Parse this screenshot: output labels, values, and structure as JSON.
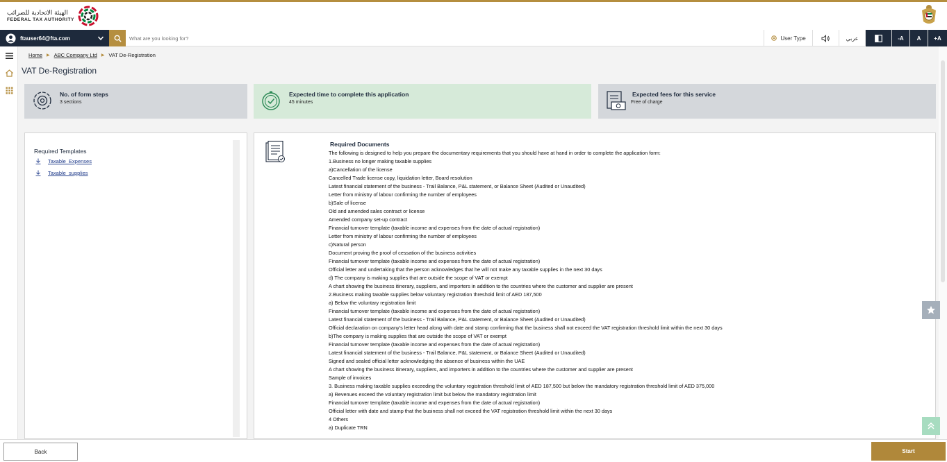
{
  "header": {
    "logo_arabic": "الهيئة الاتحادية للضرائب",
    "logo_english": "FEDERAL TAX AUTHORITY"
  },
  "toolbar": {
    "user_email": "ftauser64@fta.com",
    "search_placeholder": "What are you looking for?",
    "user_type_label": "User Type",
    "arabic_label": "عربي",
    "font_small": "-A",
    "font_medium": "A",
    "font_large": "+A"
  },
  "breadcrumb": {
    "items": [
      "Home",
      "ABC Company Ltd",
      "VAT De-Registration"
    ]
  },
  "page": {
    "title": "VAT De-Registration"
  },
  "cards": [
    {
      "title": "No. of form steps",
      "subtitle": "3 sections"
    },
    {
      "title": "Expected time to complete this application",
      "subtitle": "45 minutes"
    },
    {
      "title": "Expected fees for this service",
      "subtitle": "Free of charge"
    }
  ],
  "templates": {
    "title": "Required Templates",
    "links": [
      "Taxable_Expenses",
      "Taxable_supplies"
    ]
  },
  "documents": {
    "title": "Required Documents",
    "lines": [
      "The following is designed to help you prepare the documentary requirements that you should have at hand in order to complete the application form:",
      "1.Business no longer making taxable supplies",
      "a)Cancellation of the license",
      "Cancelled Trade license copy, liquidation letter, Board resolution",
      "Latest financial statement of the business - Trail Balance, P&L statement, or Balance Sheet (Audited or Unaudited)",
      "Letter from ministry of labour confirming the number of employees",
      "b)Sale of license",
      "Old and amended sales contract or license",
      "Amended company set-up contract",
      "Financial turnover template (taxable income and expenses from the date of actual registration)",
      "Letter from ministry of labour confirming the number of employees",
      "c)Natural person",
      "Document proving the proof of cessation of the business activities",
      "Financial turnover template (taxable income and expenses from the date of actual registration)",
      "Official letter and undertaking that the person acknowledges that he will not make any taxable supplies in the next 30 days",
      "d) The company is making supplies that are outside the scope of VAT or exempt",
      "A chart showing the business itinerary, suppliers, and importers in addition to the countries where the customer and supplier are present",
      "2.Business making taxable supplies below voluntary registration threshold limit of AED 187,500",
      "a) Below the voluntary registration limit",
      "Financial turnover template (taxable income and expenses from the date of actual registration)",
      "Latest financial statement of the business - Trail Balance, P&L statement, or Balance Sheet (Audited or Unaudited)",
      "Official declaration on company's letter head along with date and stamp confirming that the business shall not exceed the VAT registration threshold limit within the next 30 days",
      "b)The company is making supplies that are outside the scope of VAT or exempt",
      "Financial turnover template (taxable income and expenses from the date of actual registration)",
      "Latest financial statement of the business - Trail Balance, P&L statement, or Balance Sheet (Audited or Unaudited)",
      "Signed and sealed official letter acknowledging the absence of business within the UAE",
      "A chart showing the business itinerary, suppliers, and importers in addition to the countries where the customer and supplier are present",
      "Sample of invoices",
      "3. Business making taxable supplies exceeding the voluntary registration threshold limit of AED 187,500 but below the mandatory registration threshold limit of AED 375,000",
      "a) Revenues exceed the voluntary registration limit but below the mandatory registration limit",
      "Financial turnover template (taxable income and expenses from the date of actual registration)",
      "Official letter with date and stamp that the business shall not exceed the VAT registration threshold limit within the next 30 days",
      "4 Others",
      "a) Duplicate TRN"
    ]
  },
  "footer": {
    "back_label": "Back",
    "start_label": "Start"
  },
  "colors": {
    "gold": "#b58e3f",
    "navy": "#1e2a3c",
    "card_gray": "#d4d7db",
    "card_green": "#d6ead9"
  }
}
